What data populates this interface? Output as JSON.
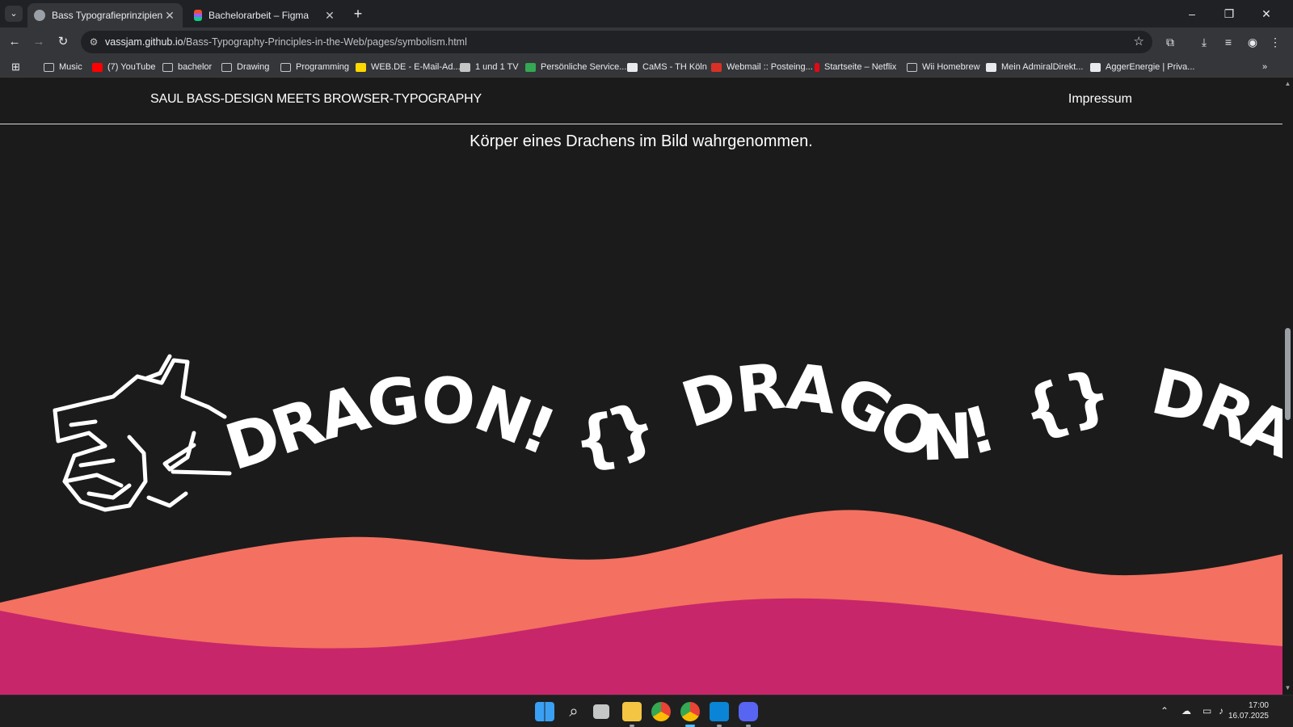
{
  "browser": {
    "tabs": [
      {
        "title": "Bass Typografieprinzipien im W",
        "active": true,
        "favicon": "globe-icon"
      },
      {
        "title": "Bachelorarbeit – Figma",
        "active": false,
        "favicon": "figma-icon"
      }
    ],
    "url_host": "vassjam.github.io",
    "url_path": "/Bass-Typography-Principles-in-the-Web/pages/symbolism.html",
    "bookmarks": [
      {
        "label": "Music",
        "icon": "folder-icon"
      },
      {
        "label": "(7) YouTube",
        "icon": "youtube-icon"
      },
      {
        "label": "bachelor",
        "icon": "folder-icon"
      },
      {
        "label": "Drawing",
        "icon": "folder-icon"
      },
      {
        "label": "Programming",
        "icon": "folder-icon"
      },
      {
        "label": "WEB.DE - E-Mail-Ad...",
        "icon": "webde-icon"
      },
      {
        "label": "1 und 1 TV",
        "icon": "tv-icon"
      },
      {
        "label": "Persönliche Service...",
        "icon": "check-icon"
      },
      {
        "label": "CaMS - TH Köln",
        "icon": "cams-icon"
      },
      {
        "label": "Webmail :: Posteing...",
        "icon": "webmail-icon"
      },
      {
        "label": "Startseite – Netflix",
        "icon": "netflix-icon"
      },
      {
        "label": "Wii Homebrew",
        "icon": "folder-icon"
      },
      {
        "label": "Mein AdmiralDirekt...",
        "icon": "admiral-icon"
      },
      {
        "label": "AggerEnergie | Priva...",
        "icon": "agger-icon"
      }
    ]
  },
  "site": {
    "title": "SAUL BASS-DESIGN MEETS BROWSER-TYPOGRAPHY",
    "nav_impressum": "Impressum",
    "caption": "Körper eines Drachens im Bild wahrgenommen.",
    "dragon_words": [
      "DRAGON!",
      "{}",
      "DRAGON!",
      "{}",
      "DRAGON!",
      "{"
    ],
    "colors": {
      "background": "#1b1b1b",
      "wave_front": "#f47060",
      "wave_back": "#c8266a",
      "text": "#ffffff"
    }
  },
  "taskbar": {
    "apps": [
      "windows-start-icon",
      "search-icon",
      "task-view-icon",
      "file-explorer-icon",
      "chrome-icon",
      "chrome-active-icon",
      "vscode-icon",
      "discord-icon"
    ],
    "time": "17:00",
    "date": "16.07.2025"
  }
}
